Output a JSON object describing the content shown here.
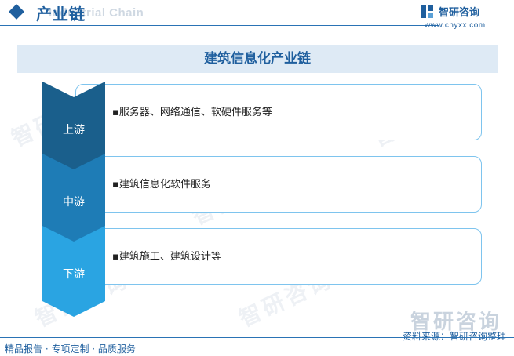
{
  "header": {
    "title": "产业链",
    "subtitle": "Industrial Chain",
    "logo_name": "智研咨询",
    "logo_url": "www.chyxx.com"
  },
  "banner": {
    "title": "建筑信息化产业链"
  },
  "stages": [
    {
      "label": "上游",
      "content": "服务器、网络通信、软硬件服务等",
      "color": "#1a5f8c"
    },
    {
      "label": "中游",
      "content": "建筑信息化软件服务",
      "color": "#1e7cb6"
    },
    {
      "label": "下游",
      "content": "建筑施工、建筑设计等",
      "color": "#2aa4e2"
    }
  ],
  "footer": {
    "left": "精品报告 · 专项定制 · 品质服务",
    "source": "资料来源：智研咨询整理",
    "watermark_brand": "智研咨询"
  },
  "colors": {
    "primary": "#1f5f9e",
    "card_border": "#7ec4ee",
    "banner_bg": "#deeaf5"
  }
}
